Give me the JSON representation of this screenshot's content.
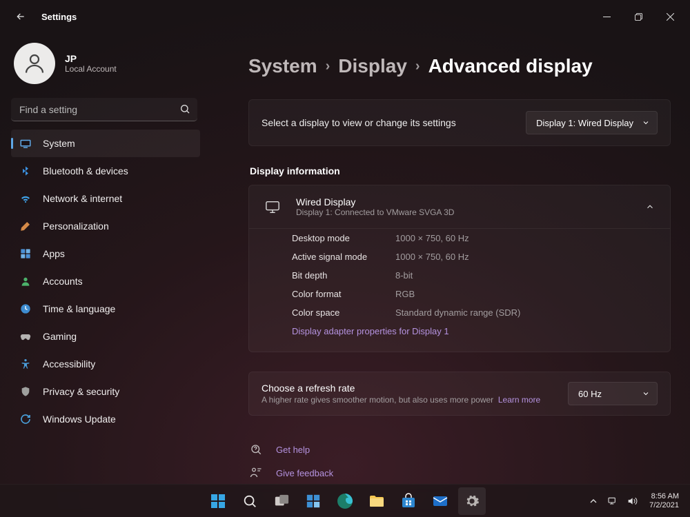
{
  "window": {
    "title": "Settings"
  },
  "profile": {
    "initials": "JP",
    "name": "JP",
    "sub": "Local Account"
  },
  "search": {
    "placeholder": "Find a setting"
  },
  "nav": {
    "items": [
      {
        "label": "System",
        "icon": "system-icon",
        "active": true
      },
      {
        "label": "Bluetooth & devices",
        "icon": "bluetooth-icon"
      },
      {
        "label": "Network & internet",
        "icon": "wifi-icon"
      },
      {
        "label": "Personalization",
        "icon": "brush-icon"
      },
      {
        "label": "Apps",
        "icon": "apps-icon"
      },
      {
        "label": "Accounts",
        "icon": "person-icon"
      },
      {
        "label": "Time & language",
        "icon": "clock-icon"
      },
      {
        "label": "Gaming",
        "icon": "gamepad-icon"
      },
      {
        "label": "Accessibility",
        "icon": "accessibility-icon"
      },
      {
        "label": "Privacy & security",
        "icon": "shield-icon"
      },
      {
        "label": "Windows Update",
        "icon": "update-icon"
      }
    ]
  },
  "breadcrumb": {
    "a": "System",
    "b": "Display",
    "c": "Advanced display"
  },
  "selectDisplay": {
    "prompt": "Select a display to view or change its settings",
    "value": "Display 1: Wired Display"
  },
  "section_info_title": "Display information",
  "display": {
    "title": "Wired Display",
    "sub": "Display 1: Connected to VMware SVGA 3D",
    "props": [
      {
        "k": "Desktop mode",
        "v": "1000 × 750, 60 Hz"
      },
      {
        "k": "Active signal mode",
        "v": "1000 × 750, 60 Hz"
      },
      {
        "k": "Bit depth",
        "v": "8-bit"
      },
      {
        "k": "Color format",
        "v": "RGB"
      },
      {
        "k": "Color space",
        "v": "Standard dynamic range (SDR)"
      }
    ],
    "adapter_link": "Display adapter properties for Display 1"
  },
  "refresh": {
    "title": "Choose a refresh rate",
    "sub": "A higher rate gives smoother motion, but also uses more power",
    "learn": "Learn more",
    "value": "60 Hz"
  },
  "footer": {
    "help": "Get help",
    "feedback": "Give feedback"
  },
  "taskbar": {
    "time": "8:56 AM",
    "date": "7/2/2021"
  }
}
